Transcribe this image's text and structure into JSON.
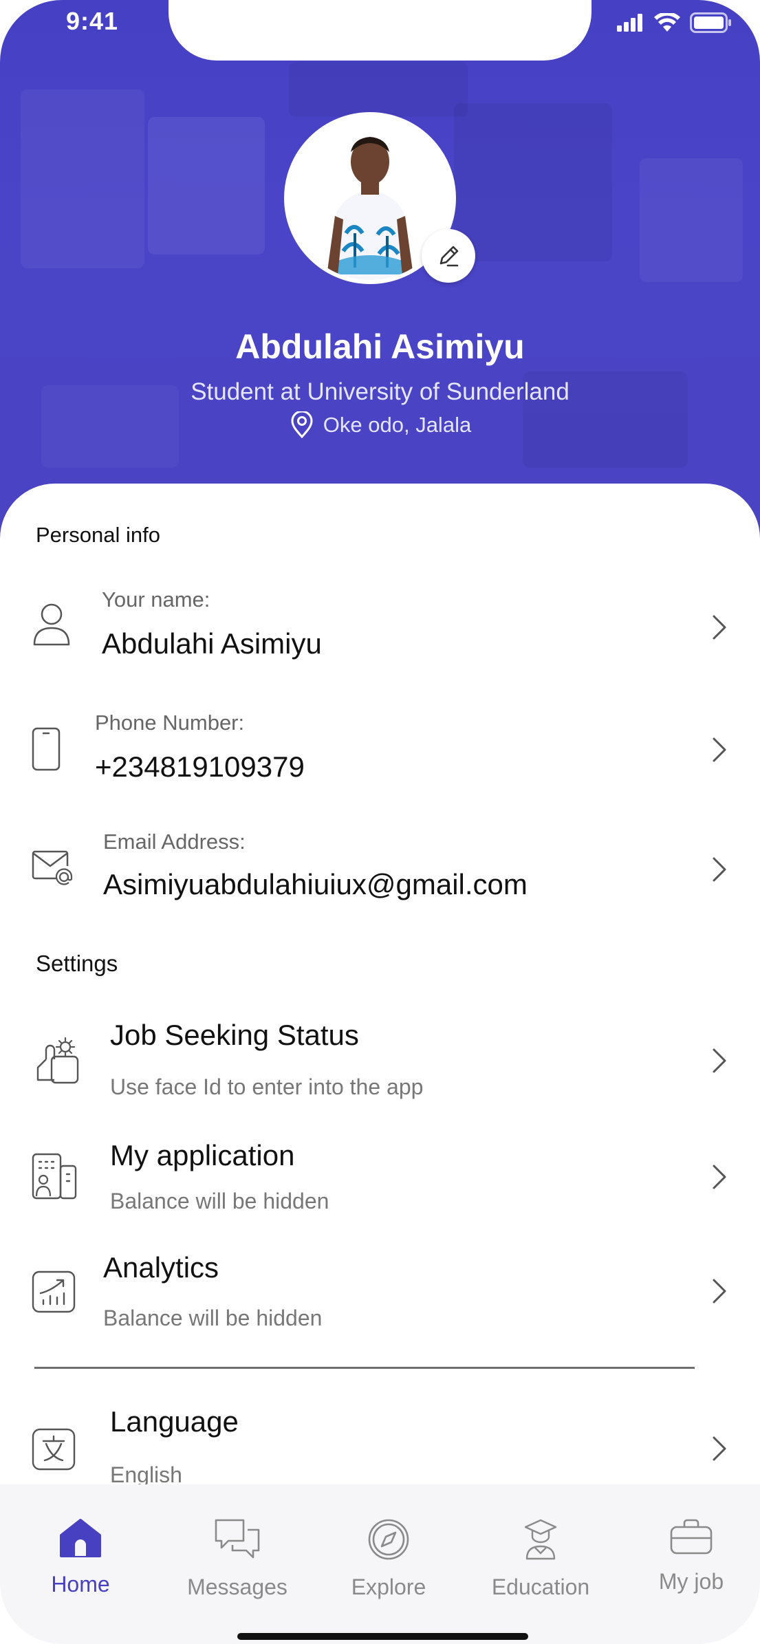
{
  "status_bar": {
    "time": "9:41"
  },
  "profile": {
    "name": "Abdulahi Asimiyu",
    "role": "Student at University of Sunderland",
    "location": "Oke odo, Jalala"
  },
  "personal_info": {
    "section_title": "Personal info",
    "items": [
      {
        "label": "Your name:",
        "value": "Abdulahi Asimiyu",
        "icon": "user-icon"
      },
      {
        "label": "Phone Number:",
        "value": "+234819109379",
        "icon": "phone-icon"
      },
      {
        "label": "Email Address:",
        "value": "Asimiyuabdulahiuiux@gmail.com",
        "icon": "email-icon"
      }
    ]
  },
  "settings": {
    "section_title": "Settings",
    "items": [
      {
        "title": "Job Seeking Status",
        "subtitle": "Use face Id to enter into the app",
        "icon": "job-status-icon"
      },
      {
        "title": "My application",
        "subtitle": "Balance will be hidden",
        "icon": "application-icon"
      },
      {
        "title": "Analytics",
        "subtitle": "Balance will be hidden",
        "icon": "analytics-icon"
      },
      {
        "title": "Language",
        "subtitle": "English",
        "icon": "language-icon"
      }
    ]
  },
  "bottom_nav": {
    "items": [
      {
        "label": "Home",
        "icon": "home-icon",
        "active": true
      },
      {
        "label": "Messages",
        "icon": "messages-icon",
        "active": false
      },
      {
        "label": "Explore",
        "icon": "compass-icon",
        "active": false
      },
      {
        "label": "Education",
        "icon": "education-icon",
        "active": false
      },
      {
        "label": "My job",
        "icon": "briefcase-icon",
        "active": false
      }
    ]
  },
  "colors": {
    "primary": "#4741c2",
    "header_bg": "#4a44c8",
    "text": "#111111",
    "muted": "#777777"
  }
}
